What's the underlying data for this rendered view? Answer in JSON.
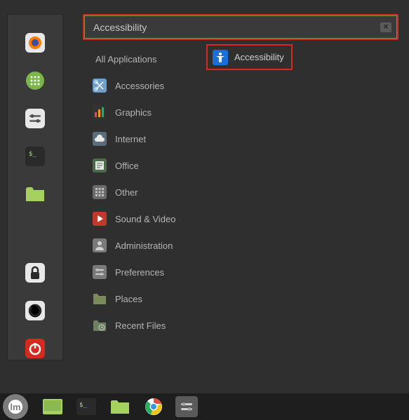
{
  "search": {
    "value": "Accessibility"
  },
  "categories": [
    {
      "id": "all",
      "label": "All Applications",
      "icon": null
    },
    {
      "id": "accessories",
      "label": "Accessories",
      "icon": "scissors"
    },
    {
      "id": "graphics",
      "label": "Graphics",
      "icon": "graphics"
    },
    {
      "id": "internet",
      "label": "Internet",
      "icon": "cloud"
    },
    {
      "id": "office",
      "label": "Office",
      "icon": "office"
    },
    {
      "id": "other",
      "label": "Other",
      "icon": "grid"
    },
    {
      "id": "sound-video",
      "label": "Sound & Video",
      "icon": "play"
    },
    {
      "id": "administration",
      "label": "Administration",
      "icon": "admin"
    },
    {
      "id": "preferences",
      "label": "Preferences",
      "icon": "prefs"
    },
    {
      "id": "places",
      "label": "Places",
      "icon": "folder"
    },
    {
      "id": "recent",
      "label": "Recent Files",
      "icon": "folder-recent"
    }
  ],
  "result": {
    "label": "Accessibility"
  },
  "panel": [
    {
      "id": "firefox",
      "name": "firefox"
    },
    {
      "id": "apps",
      "name": "apps"
    },
    {
      "id": "settings",
      "name": "settings"
    },
    {
      "id": "terminal",
      "name": "terminal"
    },
    {
      "id": "files",
      "name": "files"
    },
    {
      "id": "lock",
      "name": "lock"
    },
    {
      "id": "logout",
      "name": "logout"
    },
    {
      "id": "power",
      "name": "power"
    }
  ]
}
